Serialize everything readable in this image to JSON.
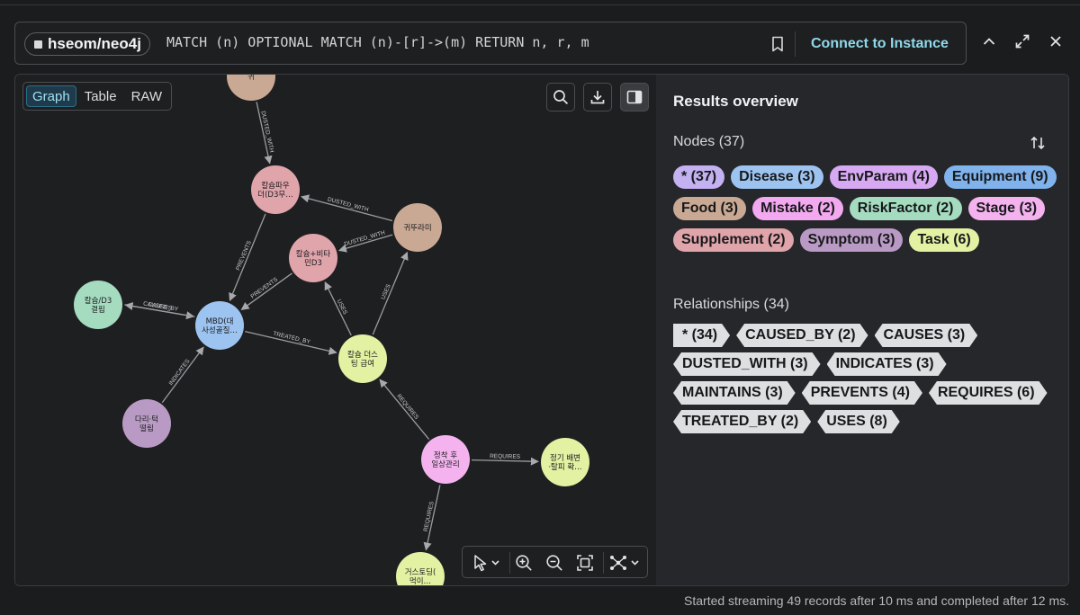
{
  "query_bar": {
    "db_name": "hseom/neo4j",
    "query": "MATCH (n) OPTIONAL MATCH (n)-[r]->(m) RETURN n, r, m",
    "connect_label": "Connect to Instance"
  },
  "view_tabs": [
    {
      "label": "Graph",
      "active": true
    },
    {
      "label": "Table",
      "active": false
    },
    {
      "label": "RAW",
      "active": false
    }
  ],
  "icons": {
    "bookmark": "bookmark-icon",
    "collapse": "chevron-up-icon",
    "expand": "expand-icon",
    "close": "close-icon",
    "search": "search-icon",
    "download": "download-icon",
    "panel": "side-panel-icon",
    "select": "pointer-icon",
    "zoom_in": "zoom-in-icon",
    "zoom_out": "zoom-out-icon",
    "fit": "fit-screen-icon",
    "layout": "layout-icon"
  },
  "graph": {
    "nodes": [
      {
        "id": "top",
        "lines": [
          "귀"
        ],
        "color": "#c9a994"
      },
      {
        "id": "calpow",
        "lines": [
          "칼슘파우",
          "더(D3무…"
        ],
        "color": "#e0a4ab"
      },
      {
        "id": "gwi",
        "lines": [
          "귀뚜라미"
        ],
        "color": "#c9a994"
      },
      {
        "id": "calvit",
        "lines": [
          "칼슘+비타",
          "민D3"
        ],
        "color": "#e0a4ab"
      },
      {
        "id": "cald3",
        "lines": [
          "칼슘/D3",
          "결핍"
        ],
        "color": "#a5dcc0"
      },
      {
        "id": "mbd",
        "lines": [
          "MBD(대",
          "사성골질…"
        ],
        "color": "#9dc3f0"
      },
      {
        "id": "dusting",
        "lines": [
          "칼슘 더스",
          "팅 급여"
        ],
        "color": "#e3f1a3"
      },
      {
        "id": "legs",
        "lines": [
          "다리·턱",
          "떨림"
        ],
        "color": "#b99ac4"
      },
      {
        "id": "daily",
        "lines": [
          "정착 후",
          "일상관리"
        ],
        "color": "#f4b3ef"
      },
      {
        "id": "shed",
        "lines": [
          "정기 배변",
          "·탈피 확…"
        ],
        "color": "#e3f1a3"
      },
      {
        "id": "gasto",
        "lines": [
          "거스토딩(",
          "먹이…"
        ],
        "color": "#e3f1a3"
      }
    ],
    "relationships": [
      {
        "from": "top",
        "to": "calpow",
        "type": "DUSTED_WITH"
      },
      {
        "from": "gwi",
        "to": "calpow",
        "type": "DUSTED_WITH"
      },
      {
        "from": "gwi",
        "to": "calvit",
        "type": "DUSTED_WITH"
      },
      {
        "from": "calpow",
        "to": "mbd",
        "type": "PREVENTS"
      },
      {
        "from": "calvit",
        "to": "mbd",
        "type": "PREVENTS"
      },
      {
        "from": "cald3",
        "to": "mbd",
        "type": "CAUSES"
      },
      {
        "from": "mbd",
        "to": "cald3",
        "type": "CAUSED_BY"
      },
      {
        "from": "mbd",
        "to": "dusting",
        "type": "TREATED_BY"
      },
      {
        "from": "dusting",
        "to": "calvit",
        "type": "USES"
      },
      {
        "from": "dusting",
        "to": "gwi",
        "type": "USES"
      },
      {
        "from": "legs",
        "to": "mbd",
        "type": "INDICATES"
      },
      {
        "from": "daily",
        "to": "dusting",
        "type": "REQUIRES"
      },
      {
        "from": "daily",
        "to": "shed",
        "type": "REQUIRES"
      },
      {
        "from": "daily",
        "to": "gasto",
        "type": "REQUIRES"
      }
    ]
  },
  "overview": {
    "title": "Results overview",
    "nodes_heading": "Nodes (37)",
    "node_labels": [
      {
        "label": "* (37)",
        "color": "#c3b1f1"
      },
      {
        "label": "Disease (3)",
        "color": "#9dc3f0"
      },
      {
        "label": "EnvParam (4)",
        "color": "#d7a9f2"
      },
      {
        "label": "Equipment (9)",
        "color": "#80b3ec"
      },
      {
        "label": "Food (3)",
        "color": "#c9a994"
      },
      {
        "label": "Mistake (2)",
        "color": "#f2a9f0"
      },
      {
        "label": "RiskFactor (2)",
        "color": "#a5dcc0"
      },
      {
        "label": "Stage (3)",
        "color": "#f4b3ef"
      },
      {
        "label": "Supplement (2)",
        "color": "#e0a4ab"
      },
      {
        "label": "Symptom (3)",
        "color": "#b99ac4"
      },
      {
        "label": "Task (6)",
        "color": "#e3f1a3"
      }
    ],
    "relationships_heading": "Relationships (34)",
    "relationship_types": [
      {
        "label": "* (34)"
      },
      {
        "label": "CAUSED_BY (2)"
      },
      {
        "label": "CAUSES (3)"
      },
      {
        "label": "DUSTED_WITH (3)"
      },
      {
        "label": "INDICATES (3)"
      },
      {
        "label": "MAINTAINS (3)"
      },
      {
        "label": "PREVENTS (4)"
      },
      {
        "label": "REQUIRES (6)"
      },
      {
        "label": "TREATED_BY (2)"
      },
      {
        "label": "USES (8)"
      }
    ]
  },
  "status": "Started streaming 49 records after 10 ms and completed after 12 ms."
}
